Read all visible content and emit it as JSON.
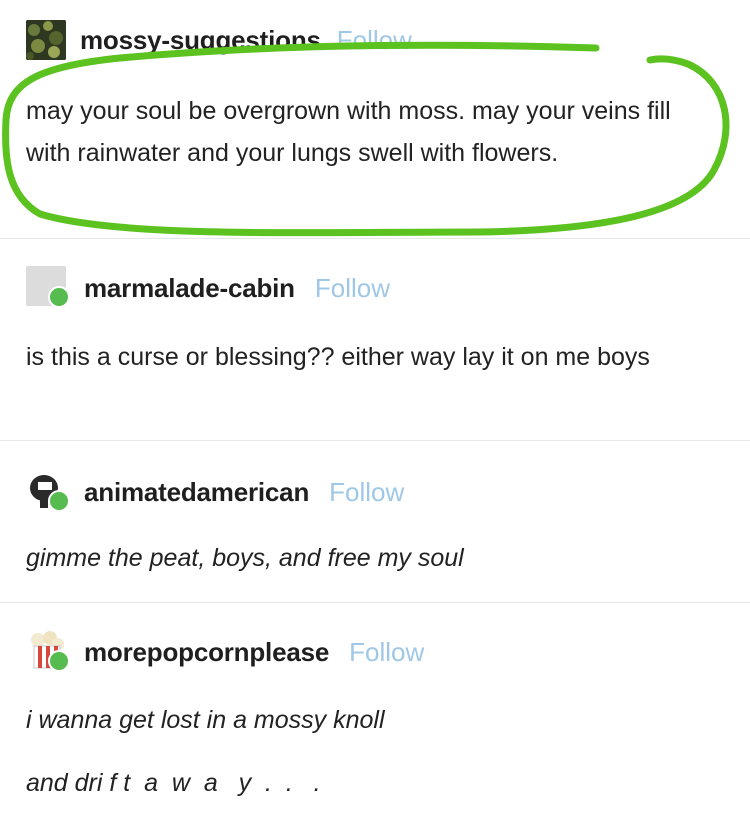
{
  "posts": [
    {
      "username": "mossy-suggestions",
      "follow_label": "Follow",
      "text": "may your soul be overgrown with moss. may your veins fill with rainwater and your lungs swell with flowers."
    },
    {
      "username": "marmalade-cabin",
      "follow_label": "Follow",
      "text": "is this a curse or blessing?? either way lay it on me boys"
    },
    {
      "username": "animatedamerican",
      "follow_label": "Follow",
      "text": "gimme the peat, boys, and free my soul"
    },
    {
      "username": "morepopcornplease",
      "follow_label": "Follow",
      "text_line1": "i wanna get lost in a mossy knoll",
      "text_line2": "and dri f t  a  w  a   y  .  .   ."
    }
  ],
  "colors": {
    "follow": "#9fc7e6",
    "reblog_badge": "#56bc4f",
    "highlight_circle": "#5cc21f"
  },
  "icons": {
    "reblog": "reblog-icon"
  }
}
